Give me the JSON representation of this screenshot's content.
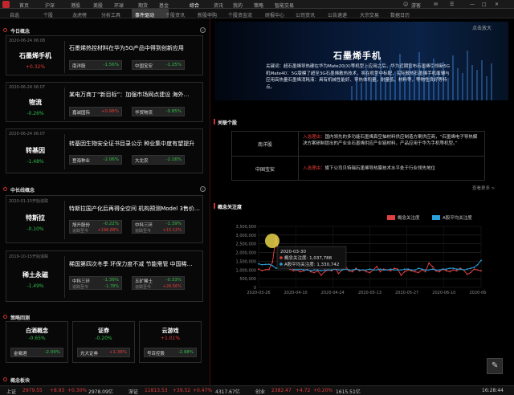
{
  "top_nav": [
    "首页",
    "沪深",
    "港股",
    "美股",
    "环球",
    "期货",
    "基金",
    "综合",
    "资讯",
    "我的",
    "策略",
    "智能交易"
  ],
  "user": {
    "name": "游客",
    "time": "16:28:44"
  },
  "menu_tabs": [
    "自选",
    "个股",
    "龙虎榜",
    "分析工具",
    "事件驱动",
    "个股资讯",
    "新股申购",
    "个股资金流",
    "研报中心",
    "公司资讯",
    "公告速递",
    "大宗交易",
    "数据日历"
  ],
  "sections": {
    "today": "今日概念",
    "mid": "中长线概念",
    "close_pos": "策略回测",
    "groups": "概念板块"
  },
  "today_cards": [
    {
      "time": "2020-06-24 06:08",
      "board": "石墨烯手机",
      "change": "+0.32%",
      "headline": "石墨烯热控材料在华为5G产品中得到创新应用",
      "stocks": [
        {
          "name": "南洋股",
          "val": "-1.56%"
        },
        {
          "name": "中国宝安",
          "val": "-1.25%"
        }
      ]
    },
    {
      "time": "2020-06-24 06:07",
      "board": "物流",
      "change": "-0.26%",
      "headline": "某电万商丁“新目标”：加强市场网点建设 海外…",
      "stocks": [
        {
          "name": "嘉诚国际",
          "val": "+0.98%"
        },
        {
          "name": "华贸物流",
          "val": "-0.85%"
        }
      ]
    },
    {
      "time": "2020-06-24 06:07",
      "board": "转基因",
      "change": "-1.48%",
      "headline": "转基因生物安全证书目录公示 种业集中度有望提升",
      "stocks": [
        {
          "name": "登海种业",
          "val": "-2.06%"
        },
        {
          "name": "大北农",
          "val": "-2.16%"
        }
      ]
    }
  ],
  "mid_cards": [
    {
      "time": "2020-01-15开始追踪",
      "board": "特斯拉",
      "change": "-0.10%",
      "headline": "特斯拉国产化后再得全空间 机构预测Model 3售价…",
      "stocks": [
        {
          "name": "旭升股份",
          "val": "-0.22%",
          "sub": "追踪至今",
          "subval": "+196.88%"
        },
        {
          "name": "中科三环",
          "val": "-1.39%",
          "sub": "追踪至今",
          "subval": "+15.12%"
        }
      ]
    },
    {
      "time": "2019-10-15开始追踪",
      "board": "稀土永磁",
      "change": "-1.49%",
      "headline": "稀国第四次冬季 环保力度不减 节能需管 中国稀…",
      "stocks": [
        {
          "name": "中科三环",
          "val": "-1.39%",
          "sub": "追踪至今",
          "subval": "-1.78%"
        },
        {
          "name": "五矿稀土",
          "val": "-0.33%",
          "sub": "追踪至今",
          "subval": "+26.56%"
        }
      ]
    }
  ],
  "group_cards": [
    {
      "name": "白酒概念",
      "change": "-0.65%",
      "stock": "金徽酒",
      "val": "-2.09%"
    },
    {
      "name": "证券",
      "change": "-0.20%",
      "stock": "光大证券",
      "val": "+1.38%"
    },
    {
      "name": "云游戏",
      "change": "+1.01%",
      "stock": "号百控股",
      "val": "-2.98%"
    }
  ],
  "hero": {
    "enlarge": "点击放大",
    "title": "石墨烯手机",
    "desc": "关键词：超石墨烯导热硬在华为Mate20(X)等机型上应用之后，华为近期宣布石墨烯引领新5G"
  },
  "hero_desc_lines": [
    "关键词：超石墨烯导热硬在华为Mate20(X)等机型上应用之后，华为近期宣布石墨烯引领新5G",
    "机Mate40：5G版模了超至3G石墨烯散热技术，将在机型中标配，实际散热石墨烯手机面辅与",
    "应用高热量石墨烯消耗液：具有机械性能好、导热体积量，耐量低、材料等，等物性良好等特",
    "点。"
  ],
  "related": {
    "title": "关联个股",
    "rows": [
      {
        "stock": "南洋股",
        "label": "入选理由：",
        "reason": "国内领先的多功能石墨烯真空抽材料供应制造方案供应商，“石墨烯电子导热解决方案研制提出的产业业石墨烯供应产业链材料，产品应用于华为手机等机型。”"
      },
      {
        "stock": "中国宝安",
        "label": "入选理由：",
        "reason": "旗下公司贝特瑞石墨烯导热膜技术水平处于行业领先地位"
      }
    ],
    "more": "查看更多 >"
  },
  "attention": {
    "title": "概念关注度",
    "legend": [
      {
        "name": "概念关注度",
        "color": "#e04040"
      },
      {
        "name": "A股平均关注度",
        "color": "#2a9fdc"
      }
    ],
    "tooltip": {
      "date": "2020-03-30",
      "line1_label": "概念关注度",
      "line1_value": "1,037,788",
      "line2_label": "A股平均关注度",
      "line2_value": "1,330,742"
    }
  },
  "chart_data": {
    "type": "line",
    "title": "概念关注度",
    "ylim": [
      0,
      3500000
    ],
    "yticks": [
      "0",
      "500,000",
      "1,000,000",
      "1,500,000",
      "2,000,000",
      "2,500,000",
      "3,000,000",
      "3,500,000"
    ],
    "xticks": [
      "2020-03-26",
      "2020-04-10",
      "2020-04-24",
      "2020-05-13",
      "2020-05-27",
      "2020-06-10",
      "2020-06-24"
    ],
    "grid": true,
    "legend_position": "top-right",
    "series": [
      {
        "name": "概念关注度",
        "color": "#e04040",
        "values": [
          1050000,
          960000,
          1020000,
          1037788,
          1450000,
          2900000,
          1700000,
          1200000,
          1100000,
          1050000,
          950000,
          1000000,
          900000,
          950000,
          1050000,
          900000,
          850000,
          950000,
          700000,
          900000,
          1000000,
          950000,
          1100000,
          800000,
          1000000,
          1200000,
          950000,
          900000,
          1100000,
          950000,
          1000000,
          900000,
          850000,
          1000000,
          1200000,
          900000,
          1050000,
          1000000,
          950000,
          1100000,
          1050000,
          700000,
          900000,
          1000000,
          950000,
          900000,
          850000,
          1000000,
          900000,
          1400000,
          1200000,
          950000,
          900000,
          1050000,
          950000,
          900000,
          1000000,
          950000,
          1100000,
          1000000,
          750000,
          850000,
          1050000,
          1000000,
          950000
        ]
      },
      {
        "name": "A股平均关注度",
        "color": "#2a9fdc",
        "values": [
          1350000,
          1300000,
          1320000,
          1330742,
          1250000,
          1100000,
          1200000,
          1150000,
          1200000,
          1100000,
          1050000,
          1000000,
          1050000,
          1000000,
          1000000,
          950000,
          1000000,
          1000000,
          950000,
          1000000,
          1000000,
          1000000,
          1050000,
          1000000,
          1000000,
          1050000,
          1000000,
          1000000,
          1050000,
          1000000,
          1000000,
          1000000,
          1050000,
          1000000,
          1000000,
          1050000,
          1000000,
          1000000,
          1050000,
          1000000,
          1000000,
          1000000,
          1050000,
          1050000,
          1000000,
          1000000,
          1100000,
          1050000,
          1000000,
          1000000,
          1050000,
          1000000,
          1000000,
          1050000,
          1050000,
          1100000,
          1100000,
          1050000,
          1050000,
          1000000,
          1050000,
          1100000,
          1150000,
          1300000,
          1550000
        ]
      }
    ]
  },
  "ticker": [
    {
      "name": "上证",
      "value": "2979.55",
      "chg": "+8.93",
      "pct": "+0.30%",
      "amt": "2978.09亿",
      "color": "#e23b3b"
    },
    {
      "name": "深证",
      "value": "11813.53",
      "chg": "+39.52",
      "pct": "+0.47%",
      "amt": "4317.67亿",
      "color": "#e23b3b"
    },
    {
      "name": "创业",
      "value": "2382.47",
      "chg": "+4.72",
      "pct": "+0.20%",
      "amt": "1615.51亿",
      "color": "#e23b3b"
    }
  ]
}
